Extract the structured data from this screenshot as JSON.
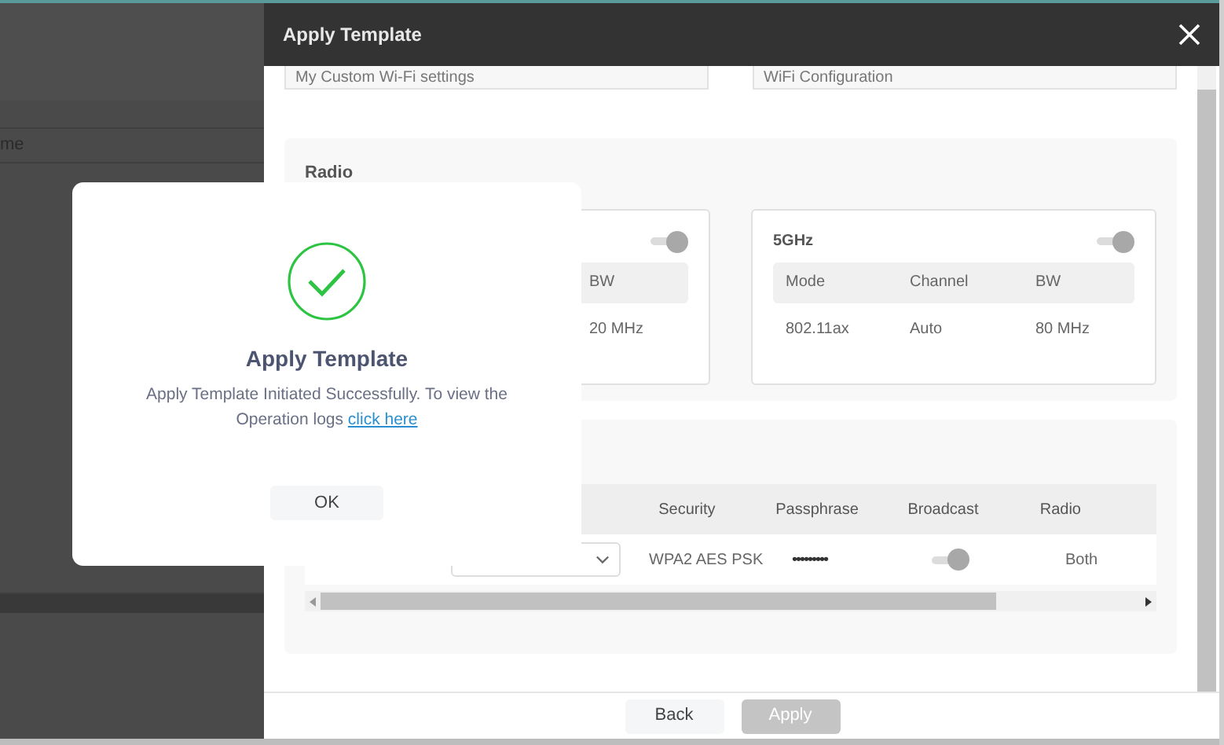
{
  "background": {
    "column_header": "me"
  },
  "panel": {
    "title": "Apply Template",
    "fields": [
      {
        "value": "My Custom Wi-Fi settings"
      },
      {
        "value": "WiFi Configuration"
      }
    ],
    "radio": {
      "title": "Radio",
      "bands": [
        {
          "on": true,
          "columns": [
            {
              "header": "BW",
              "value": "20 MHz"
            }
          ]
        },
        {
          "name": "5GHz",
          "on": true,
          "columns": [
            {
              "header": "Mode",
              "value": "802.11ax"
            },
            {
              "header": "Channel",
              "value": "Auto"
            },
            {
              "header": "BW",
              "value": "80 MHz"
            }
          ]
        }
      ]
    },
    "networks": {
      "columns": [
        "Security",
        "Passphrase",
        "Broadcast",
        "Radio"
      ],
      "rows": [
        {
          "security": "WPA2 AES PSK",
          "passphrase": "•••••••••",
          "broadcast": true,
          "radio": "Both"
        }
      ]
    },
    "buttons": [
      {
        "label": "Back",
        "disabled": false
      },
      {
        "label": "Apply",
        "disabled": true
      }
    ]
  },
  "dialog": {
    "title": "Apply Template",
    "message": "Apply Template Initiated Successfully. To view the Operation logs",
    "link": "click here",
    "button": "OK"
  }
}
